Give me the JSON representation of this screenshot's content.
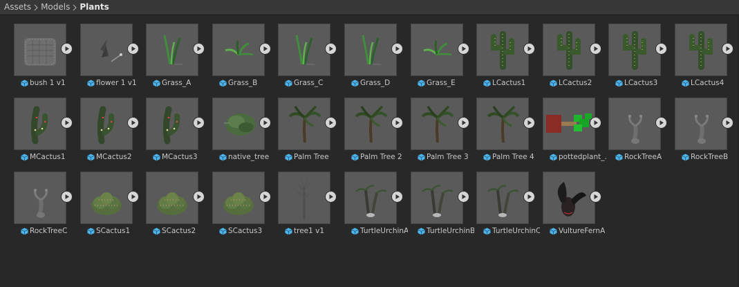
{
  "breadcrumb": [
    "Assets",
    "Models",
    "Plants"
  ],
  "colors": {
    "background": "#282828",
    "toolbar": "#373737",
    "thumbnail_bg": "#5a5a5a",
    "prefab_icon": "#4fb3e8",
    "play_button": "#d6d6d6"
  },
  "assets": [
    {
      "name": "bush 1 v1",
      "preview": "bush-mesh"
    },
    {
      "name": "flower 1 v1",
      "preview": "flower"
    },
    {
      "name": "Grass_A",
      "preview": "grass-tall"
    },
    {
      "name": "Grass_B",
      "preview": "grass-tuft"
    },
    {
      "name": "Grass_C",
      "preview": "grass-tall"
    },
    {
      "name": "Grass_D",
      "preview": "grass-tall"
    },
    {
      "name": "Grass_E",
      "preview": "grass-tuft"
    },
    {
      "name": "LCactus1",
      "preview": "large-cactus"
    },
    {
      "name": "LCactus2",
      "preview": "large-cactus"
    },
    {
      "name": "LCactus3",
      "preview": "large-cactus"
    },
    {
      "name": "LCactus4",
      "preview": "large-cactus"
    },
    {
      "name": "MCactus1",
      "preview": "medium-cactus"
    },
    {
      "name": "MCactus2",
      "preview": "medium-cactus"
    },
    {
      "name": "MCactus3",
      "preview": "medium-cactus"
    },
    {
      "name": "native_tree",
      "preview": "native-tree"
    },
    {
      "name": "Palm Tree",
      "preview": "palm-tree"
    },
    {
      "name": "Palm Tree 2",
      "preview": "palm-tree"
    },
    {
      "name": "Palm Tree 3",
      "preview": "palm-tree"
    },
    {
      "name": "Palm Tree 4",
      "preview": "palm-tree"
    },
    {
      "name": "pottedplant_...",
      "preview": "potted-plant"
    },
    {
      "name": "RockTreeA",
      "preview": "rock-tree"
    },
    {
      "name": "RockTreeB",
      "preview": "rock-tree"
    },
    {
      "name": "RockTreeC",
      "preview": "rock-tree"
    },
    {
      "name": "SCactus1",
      "preview": "small-cactus"
    },
    {
      "name": "SCactus2",
      "preview": "small-cactus"
    },
    {
      "name": "SCactus3",
      "preview": "small-cactus"
    },
    {
      "name": "tree1 v1",
      "preview": "bare-tree"
    },
    {
      "name": "TurtleUrchinA",
      "preview": "turtle-urchin"
    },
    {
      "name": "TurtleUrchinB",
      "preview": "turtle-urchin"
    },
    {
      "name": "TurtleUrchinC",
      "preview": "turtle-urchin"
    },
    {
      "name": "VultureFernA",
      "preview": "vulture-fern"
    }
  ]
}
